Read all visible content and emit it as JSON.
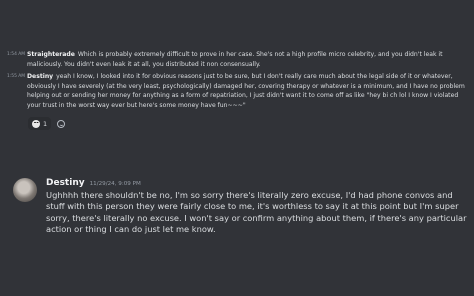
{
  "messages_compact": [
    {
      "timestamp": "1:54 AM",
      "author": "Straighterade",
      "text": "Which is probably extremely difficult to prove in her case. She's not a high profile micro celebrity, and you didn't leak it maliciously. You didn't even leak it at all, you distributed it non consensually."
    },
    {
      "timestamp": "1:55 AM",
      "author": "Destiny",
      "text": "yeah I know, I looked into it for obvious reasons just to be sure, but I don't really care much about the legal side of it or whatever, obviously I have severely (at the very least, psychologically) damaged her, covering therapy or whatever is a minimum, and I have no problem helping out or sending her money for anything as a form of repatriation, I just didn't want it to come off as like \"hey bi ch lol I know I violated your trust in the worst way ever but here's some money have fun~~~\""
    }
  ],
  "reactions": [
    {
      "emoji": "skull-face",
      "count": "1"
    }
  ],
  "message_cozy": {
    "author": "Destiny",
    "timestamp": "11/29/24, 9:09 PM",
    "text": "Ughhhh there shouldn't be no, I'm so sorry there's literally zero excuse, I'd had phone convos and stuff with this person they were fairly close to me, it's worthless to say it at this point but I'm super sorry, there's literally no excuse. I won't say or confirm anything about them, if there's any particular action or thing I can do just let me know."
  },
  "colors": {
    "background": "#313338",
    "text": "#dbdee1",
    "author": "#f2f3f5",
    "muted": "#949ba4"
  }
}
